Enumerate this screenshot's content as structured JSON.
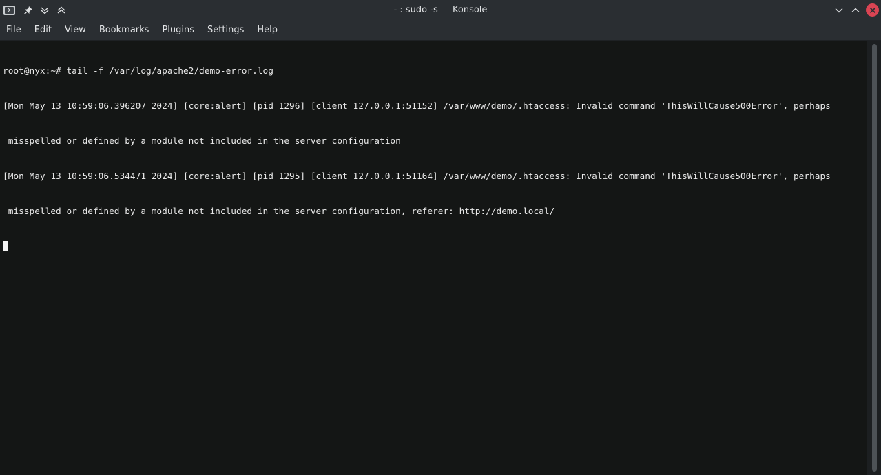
{
  "window": {
    "title": "- : sudo -s — Konsole",
    "icons": [
      "konsole-app-icon",
      "pin-icon",
      "keep-below-icon",
      "keep-above-icon",
      "minimize-icon",
      "maximize-icon",
      "close-icon"
    ]
  },
  "menu": {
    "items": [
      "File",
      "Edit",
      "View",
      "Bookmarks",
      "Plugins",
      "Settings",
      "Help"
    ]
  },
  "terminal": {
    "lines": [
      "root@nyx:~# tail -f /var/log/apache2/demo-error.log",
      "[Mon May 13 10:59:06.396207 2024] [core:alert] [pid 1296] [client 127.0.0.1:51152] /var/www/demo/.htaccess: Invalid command 'ThisWillCause500Error', perhaps",
      " misspelled or defined by a module not included in the server configuration",
      "[Mon May 13 10:59:06.534471 2024] [core:alert] [pid 1295] [client 127.0.0.1:51164] /var/www/demo/.htaccess: Invalid command 'ThisWillCause500Error', perhaps",
      " misspelled or defined by a module not included in the server configuration, referer: http://demo.local/"
    ]
  },
  "colors": {
    "titlebar_bg": "#2a2e32",
    "terminal_bg": "#141615",
    "terminal_fg": "#e8e8e8",
    "close_button": "#da4453"
  }
}
